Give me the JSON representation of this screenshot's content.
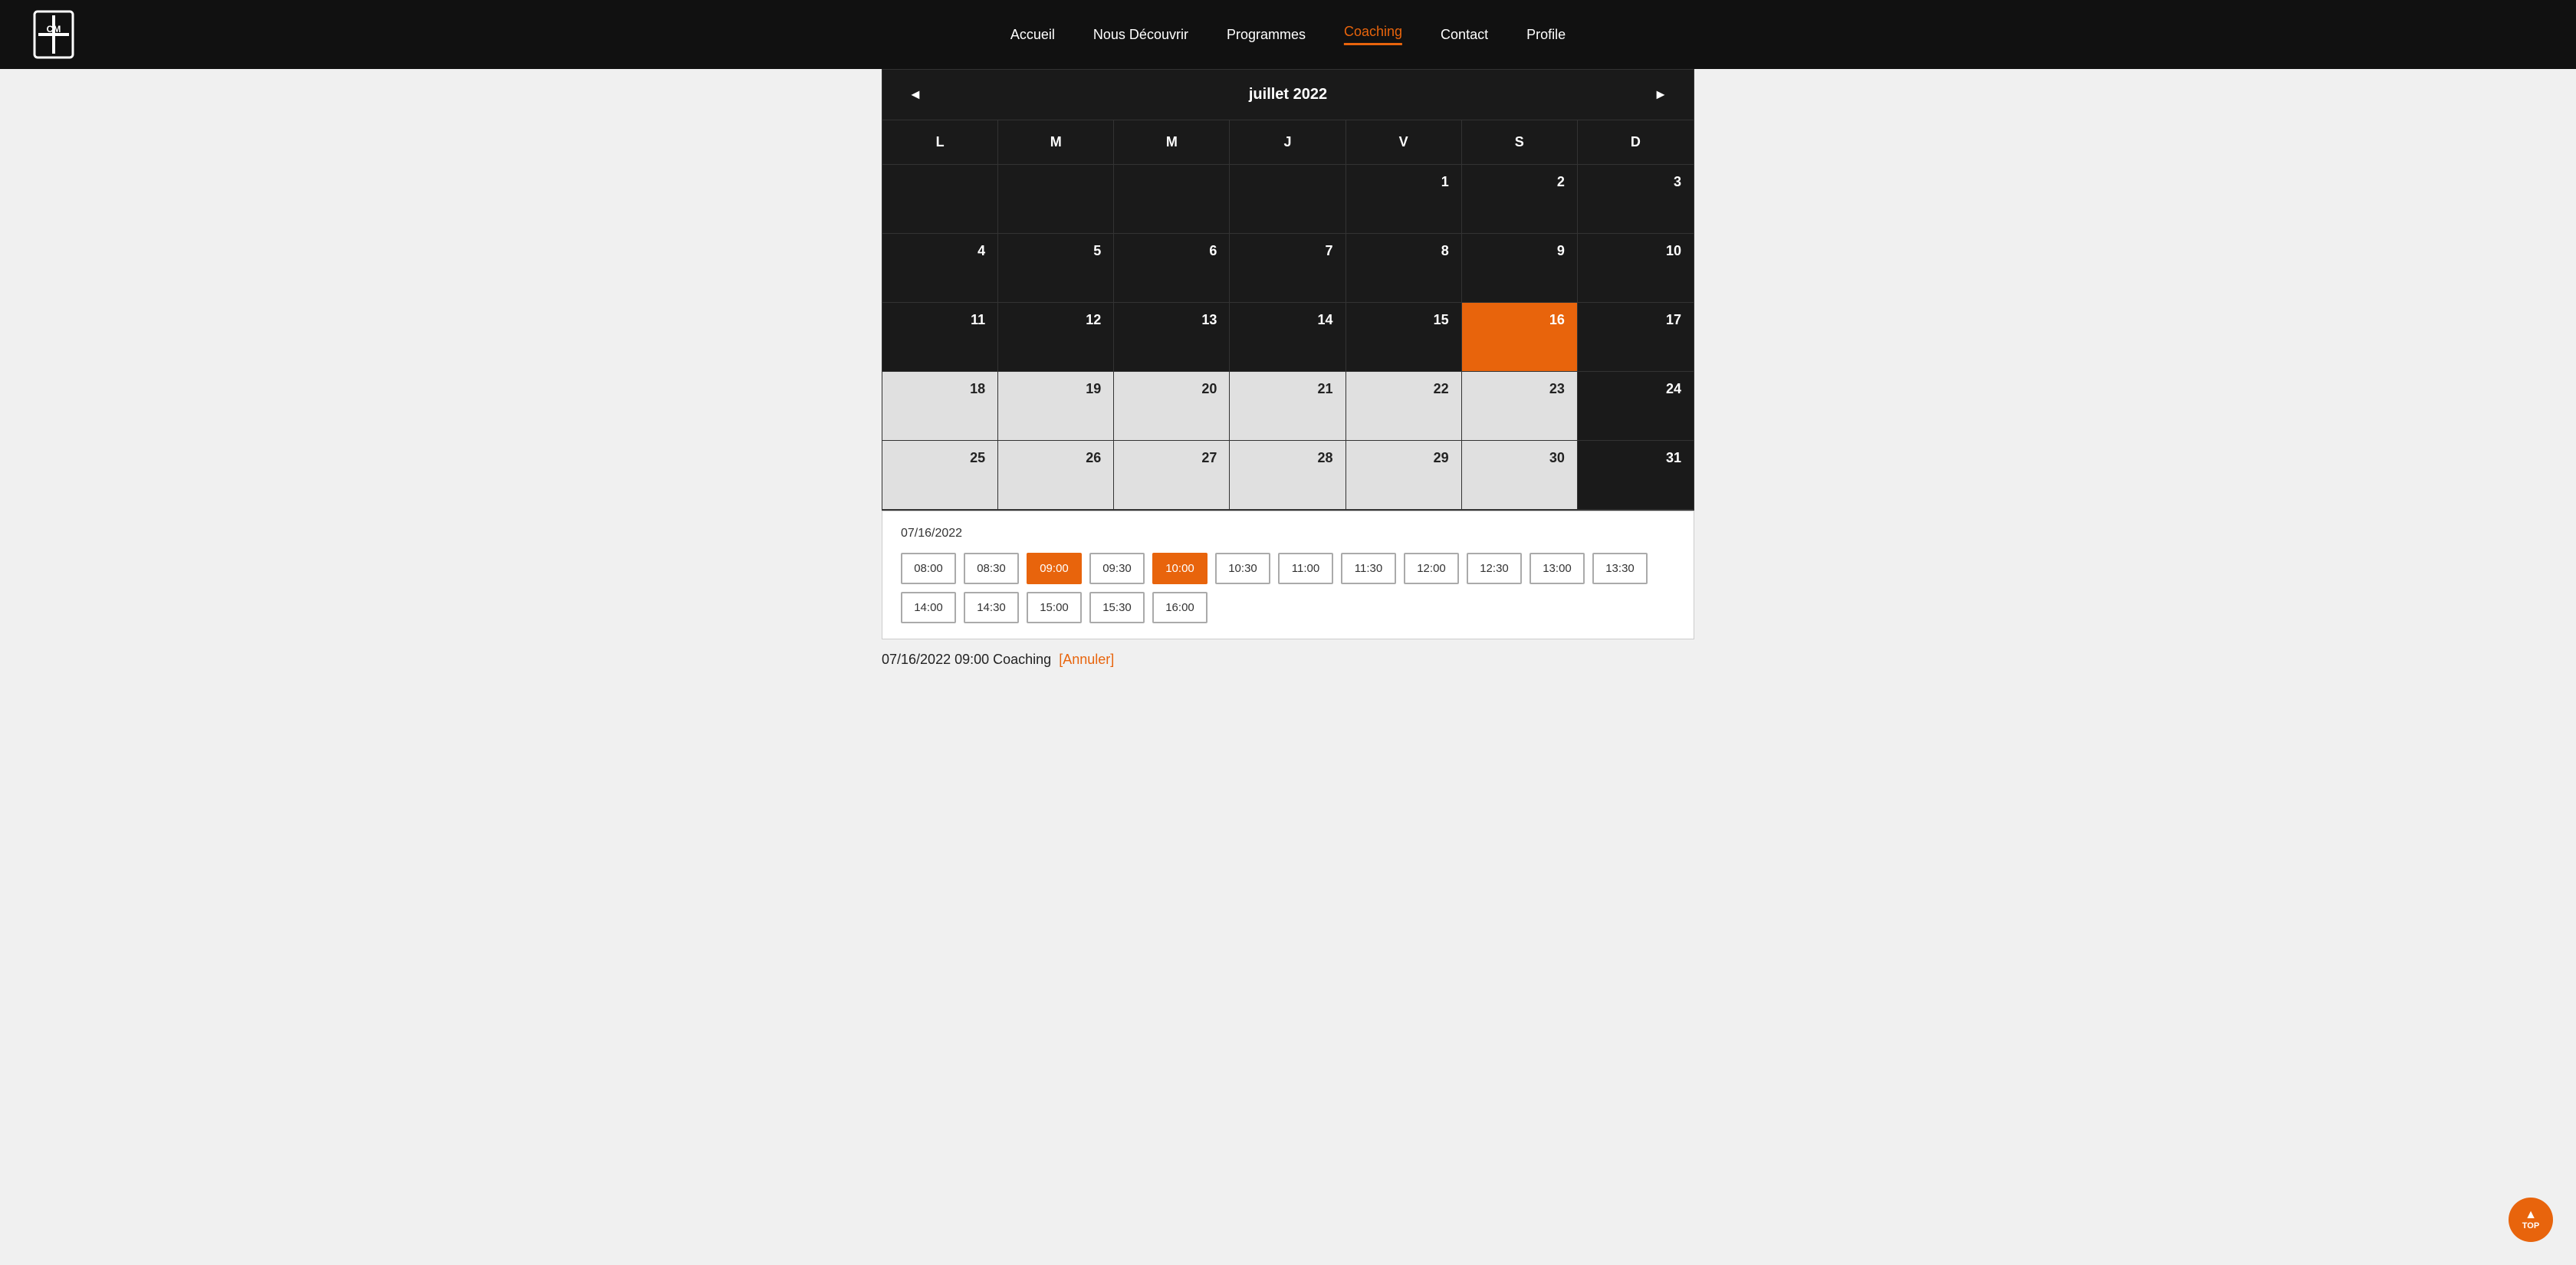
{
  "header": {
    "logo_text": "CM",
    "nav_items": [
      {
        "label": "Accueil",
        "active": false
      },
      {
        "label": "Nous Découvrir",
        "active": false
      },
      {
        "label": "Programmes",
        "active": false
      },
      {
        "label": "Coaching",
        "active": true
      },
      {
        "label": "Contact",
        "active": false
      },
      {
        "label": "Profile",
        "active": false
      }
    ]
  },
  "calendar": {
    "month": "juillet 2022",
    "prev_label": "◄",
    "next_label": "►",
    "day_headers": [
      "L",
      "M",
      "M",
      "J",
      "V",
      "S",
      "D"
    ],
    "weeks": [
      [
        {
          "num": "",
          "type": "empty-dark"
        },
        {
          "num": "",
          "type": "empty-dark"
        },
        {
          "num": "",
          "type": "empty-dark"
        },
        {
          "num": "",
          "type": "empty-dark"
        },
        {
          "num": "1",
          "type": "dark"
        },
        {
          "num": "2",
          "type": "dark"
        },
        {
          "num": "3",
          "type": "dark"
        }
      ],
      [
        {
          "num": "4",
          "type": "dark"
        },
        {
          "num": "5",
          "type": "dark"
        },
        {
          "num": "6",
          "type": "dark"
        },
        {
          "num": "7",
          "type": "dark"
        },
        {
          "num": "8",
          "type": "dark"
        },
        {
          "num": "9",
          "type": "dark"
        },
        {
          "num": "10",
          "type": "dark"
        }
      ],
      [
        {
          "num": "11",
          "type": "dark"
        },
        {
          "num": "12",
          "type": "dark"
        },
        {
          "num": "13",
          "type": "dark"
        },
        {
          "num": "14",
          "type": "dark"
        },
        {
          "num": "15",
          "type": "dark"
        },
        {
          "num": "16",
          "type": "selected"
        },
        {
          "num": "17",
          "type": "dark"
        }
      ],
      [
        {
          "num": "18",
          "type": "light"
        },
        {
          "num": "19",
          "type": "light"
        },
        {
          "num": "20",
          "type": "light"
        },
        {
          "num": "21",
          "type": "light"
        },
        {
          "num": "22",
          "type": "light"
        },
        {
          "num": "23",
          "type": "light"
        },
        {
          "num": "24",
          "type": "dark"
        }
      ],
      [
        {
          "num": "25",
          "type": "light"
        },
        {
          "num": "26",
          "type": "light"
        },
        {
          "num": "27",
          "type": "light"
        },
        {
          "num": "28",
          "type": "light"
        },
        {
          "num": "29",
          "type": "light"
        },
        {
          "num": "30",
          "type": "light"
        },
        {
          "num": "31",
          "type": "dark"
        }
      ]
    ]
  },
  "timeslot_section": {
    "date_label": "07/16/2022",
    "slots": [
      {
        "time": "08:00",
        "state": "normal"
      },
      {
        "time": "08:30",
        "state": "normal"
      },
      {
        "time": "09:00",
        "state": "selected"
      },
      {
        "time": "09:30",
        "state": "normal"
      },
      {
        "time": "10:00",
        "state": "booked"
      },
      {
        "time": "10:30",
        "state": "normal"
      },
      {
        "time": "11:00",
        "state": "normal"
      },
      {
        "time": "11:30",
        "state": "normal"
      },
      {
        "time": "12:00",
        "state": "normal"
      },
      {
        "time": "12:30",
        "state": "normal"
      },
      {
        "time": "13:00",
        "state": "normal"
      },
      {
        "time": "13:30",
        "state": "normal"
      },
      {
        "time": "14:00",
        "state": "normal"
      },
      {
        "time": "14:30",
        "state": "normal"
      },
      {
        "time": "15:00",
        "state": "normal"
      },
      {
        "time": "15:30",
        "state": "normal"
      },
      {
        "time": "16:00",
        "state": "normal"
      }
    ]
  },
  "booking_info": {
    "text": "07/16/2022 09:00  Coaching",
    "cancel_label": "[Annuler]"
  },
  "scroll_top": {
    "arrow": "▲",
    "label": "TOP"
  }
}
